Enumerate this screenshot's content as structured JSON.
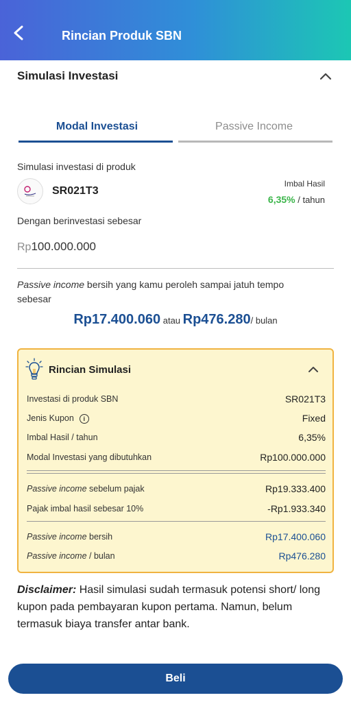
{
  "header": {
    "title": "Rincian Produk SBN",
    "back_icon": "arrow-left-icon"
  },
  "section": {
    "title": "Simulasi Investasi"
  },
  "tabs": [
    {
      "label": "Modal Investasi",
      "active": true
    },
    {
      "label": "Passive Income",
      "active": false
    }
  ],
  "simulation": {
    "product_label": "Simulasi investasi di produk",
    "product_code": "SR021T3",
    "yield_label": "Imbal Hasil",
    "yield_value": "6,35%",
    "yield_unit": "/ tahun",
    "invest_label": "Dengan berinvestasi sebesar",
    "amount_currency": "Rp",
    "amount_value": "100.000.000",
    "note_italic": "Passive income",
    "note_rest": " bersih yang kamu peroleh sampai jatuh tempo sebesar",
    "result_total": "Rp17.400.060",
    "result_or": " atau ",
    "result_monthly": "Rp476.280",
    "result_unit": "/ bulan"
  },
  "card": {
    "title": "Rincian Simulasi",
    "rows": [
      {
        "label": "Investasi di produk SBN",
        "value": "SR021T3"
      },
      {
        "label": "Jenis Kupon",
        "value": "Fixed",
        "info": "i"
      },
      {
        "label": "Imbal Hasil / tahun",
        "value": "6,35%"
      },
      {
        "label": "Modal Investasi yang dibutuhkan",
        "value": "Rp100.000.000"
      },
      {
        "label_italic": "Passive income",
        "label": " sebelum pajak",
        "value": "Rp19.333.400"
      },
      {
        "label": "Pajak imbal hasil sebesar 10%",
        "value": "-Rp1.933.340"
      },
      {
        "label_italic": "Passive income",
        "label": " bersih",
        "value": "Rp17.400.060"
      },
      {
        "label_italic": "Passive income",
        "label": " / bulan",
        "value": "Rp476.280"
      }
    ]
  },
  "disclaimer": {
    "prefix": "Disclaimer:",
    "text": " Hasil simulasi sudah termasuk potensi short/ long kupon pada pembayaran kupon pertama. Namun, belum termasuk biaya transfer antar bank."
  },
  "buy_button": {
    "label": "Beli"
  },
  "colors": {
    "primary": "#1b4f93",
    "green": "#3bb54a",
    "card_bg": "#fdf6cf",
    "card_border": "#f0b340"
  }
}
